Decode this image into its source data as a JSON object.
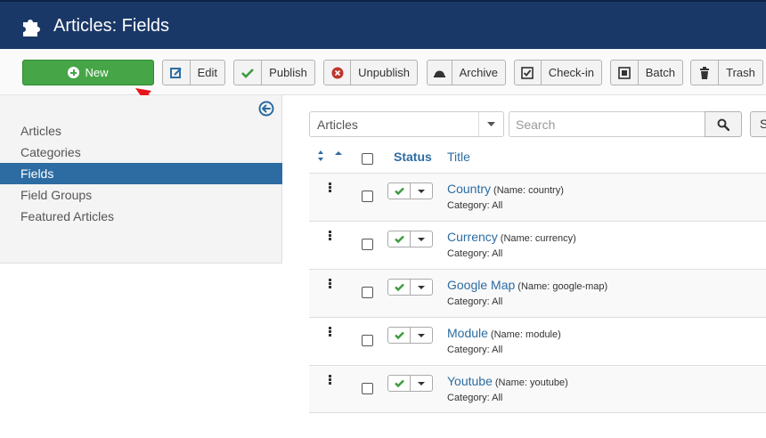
{
  "header": {
    "title": "Articles: Fields",
    "icon": "puzzle-icon"
  },
  "toolbar": {
    "new_label": "New",
    "buttons": [
      {
        "label": "Edit",
        "icon": "edit-icon"
      },
      {
        "label": "Publish",
        "icon": "check-icon"
      },
      {
        "label": "Unpublish",
        "icon": "circle-x-icon"
      },
      {
        "label": "Archive",
        "icon": "archive-icon"
      },
      {
        "label": "Check-in",
        "icon": "checkbox-icon"
      },
      {
        "label": "Batch",
        "icon": "batch-icon"
      },
      {
        "label": "Trash",
        "icon": "trash-icon"
      }
    ]
  },
  "sidebar": {
    "items": [
      {
        "label": "Articles",
        "active": false
      },
      {
        "label": "Categories",
        "active": false
      },
      {
        "label": "Fields",
        "active": true
      },
      {
        "label": "Field Groups",
        "active": false
      },
      {
        "label": "Featured Articles",
        "active": false
      }
    ]
  },
  "filters": {
    "context_select": "Articles",
    "search_placeholder": "Search",
    "extra_button": "S"
  },
  "table": {
    "columns": {
      "status": "Status",
      "title": "Title"
    },
    "rows": [
      {
        "title": "Country",
        "alias": "(Name: country)",
        "category": "Category: All"
      },
      {
        "title": "Currency",
        "alias": "(Name: currency)",
        "category": "Category: All"
      },
      {
        "title": "Google Map",
        "alias": "(Name: google-map)",
        "category": "Category: All"
      },
      {
        "title": "Module",
        "alias": "(Name: module)",
        "category": "Category: All"
      },
      {
        "title": "Youtube",
        "alias": "(Name: youtube)",
        "category": "Category: All"
      }
    ]
  },
  "colors": {
    "header_bg": "#1a3867",
    "new_button": "#46a546",
    "link": "#2d6ca2",
    "sidebar_active": "#2d6ca2",
    "annotation_arrow": "#e8141b",
    "publish_check": "#3c9a3c"
  }
}
